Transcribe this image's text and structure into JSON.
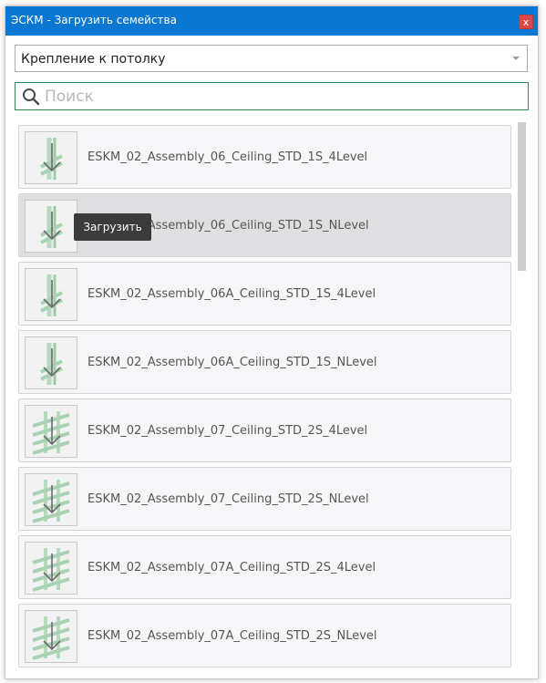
{
  "window": {
    "title": "ЭСКМ - Загрузить семейства",
    "close_label": "x"
  },
  "category_select": {
    "value": "Крепление к потолку"
  },
  "search": {
    "placeholder": "Поиск",
    "value": ""
  },
  "families": [
    {
      "label": "ESKM_02_Assembly_06_Ceiling_STD_1S_4Level",
      "icon": "single-strut-icon"
    },
    {
      "label": "ESKM_02_Assembly_06_Ceiling_STD_1S_NLevel",
      "icon": "single-strut-icon",
      "state": "hover"
    },
    {
      "label": "ESKM_02_Assembly_06A_Ceiling_STD_1S_4Level",
      "icon": "single-strut-icon"
    },
    {
      "label": "ESKM_02_Assembly_06A_Ceiling_STD_1S_NLevel",
      "icon": "single-strut-icon"
    },
    {
      "label": "ESKM_02_Assembly_07_Ceiling_STD_2S_4Level",
      "icon": "double-strut-icon"
    },
    {
      "label": "ESKM_02_Assembly_07_Ceiling_STD_2S_NLevel",
      "icon": "double-strut-icon"
    },
    {
      "label": "ESKM_02_Assembly_07A_Ceiling_STD_2S_4Level",
      "icon": "double-strut-icon"
    },
    {
      "label": "ESKM_02_Assembly_07A_Ceiling_STD_2S_NLevel",
      "icon": "double-strut-icon"
    }
  ],
  "tooltip": {
    "text": "Загрузить"
  },
  "colors": {
    "titlebar": "#0a78d2",
    "close": "#d64a4a",
    "search_border": "#2e8b57",
    "card_bg": "#f6f6f8",
    "card_hover_bg": "#dfdfe2",
    "tooltip_bg": "#3b3b3b"
  }
}
